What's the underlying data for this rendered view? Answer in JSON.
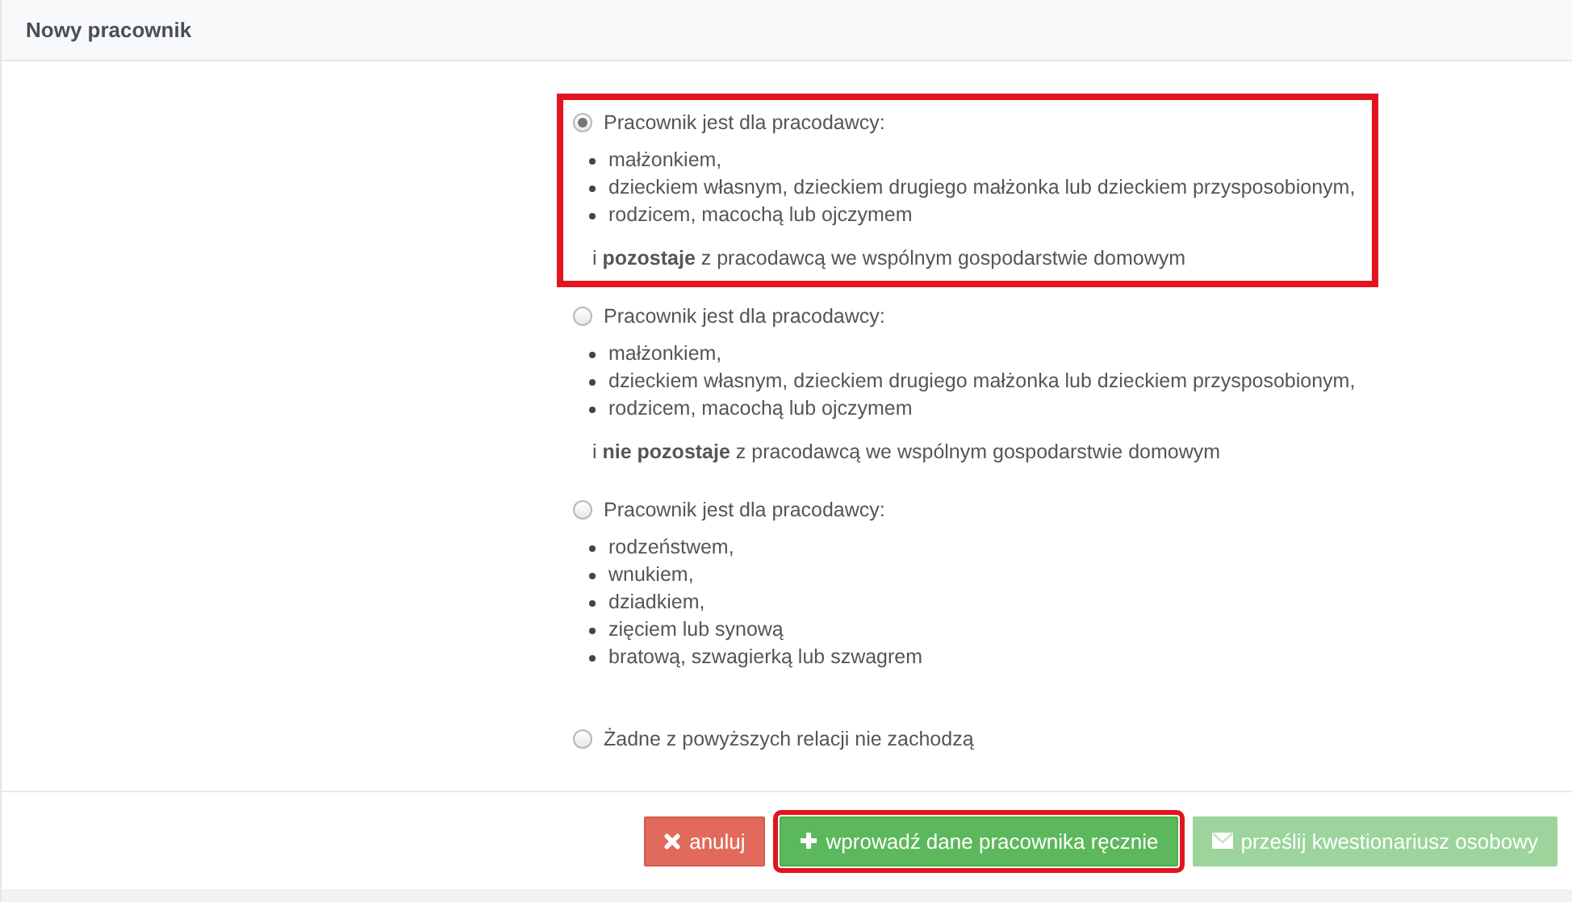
{
  "header": {
    "title": "Nowy pracownik"
  },
  "options": [
    {
      "label": "Pracownik jest dla pracodawcy:",
      "selected": true,
      "highlighted": true,
      "items": [
        "małżonkiem,",
        "dzieckiem własnym, dzieckiem drugiego małżonka lub dzieckiem przysposobionym,",
        "rodzicem, macochą lub ojczymem"
      ],
      "note": "i **pozostaje** z pracodawcą we wspólnym gospodarstwie domowym"
    },
    {
      "label": "Pracownik jest dla pracodawcy:",
      "selected": false,
      "highlighted": false,
      "items": [
        "małżonkiem,",
        "dzieckiem własnym, dzieckiem drugiego małżonka lub dzieckiem przysposobionym,",
        "rodzicem, macochą lub ojczymem"
      ],
      "note": "i **nie pozostaje** z pracodawcą we wspólnym gospodarstwie domowym"
    },
    {
      "label": "Pracownik jest dla pracodawcy:",
      "selected": false,
      "highlighted": false,
      "items": [
        "rodzeństwem,",
        "wnukiem,",
        "dziadkiem,",
        "zięciem lub synową",
        "bratową, szwagierką lub szwagrem"
      ]
    },
    {
      "label": "Żadne z powyższych relacji nie zachodzą",
      "selected": false,
      "highlighted": false
    }
  ],
  "buttons": [
    {
      "kind": "cancel",
      "label": "anuluj",
      "disabled": false,
      "highlighted": false
    },
    {
      "kind": "add",
      "label": "wprowadź dane pracownika ręcznie",
      "disabled": false,
      "highlighted": true
    },
    {
      "kind": "send",
      "label": "prześlij kwestionariusz osobowy",
      "disabled": true,
      "highlighted": false
    }
  ]
}
